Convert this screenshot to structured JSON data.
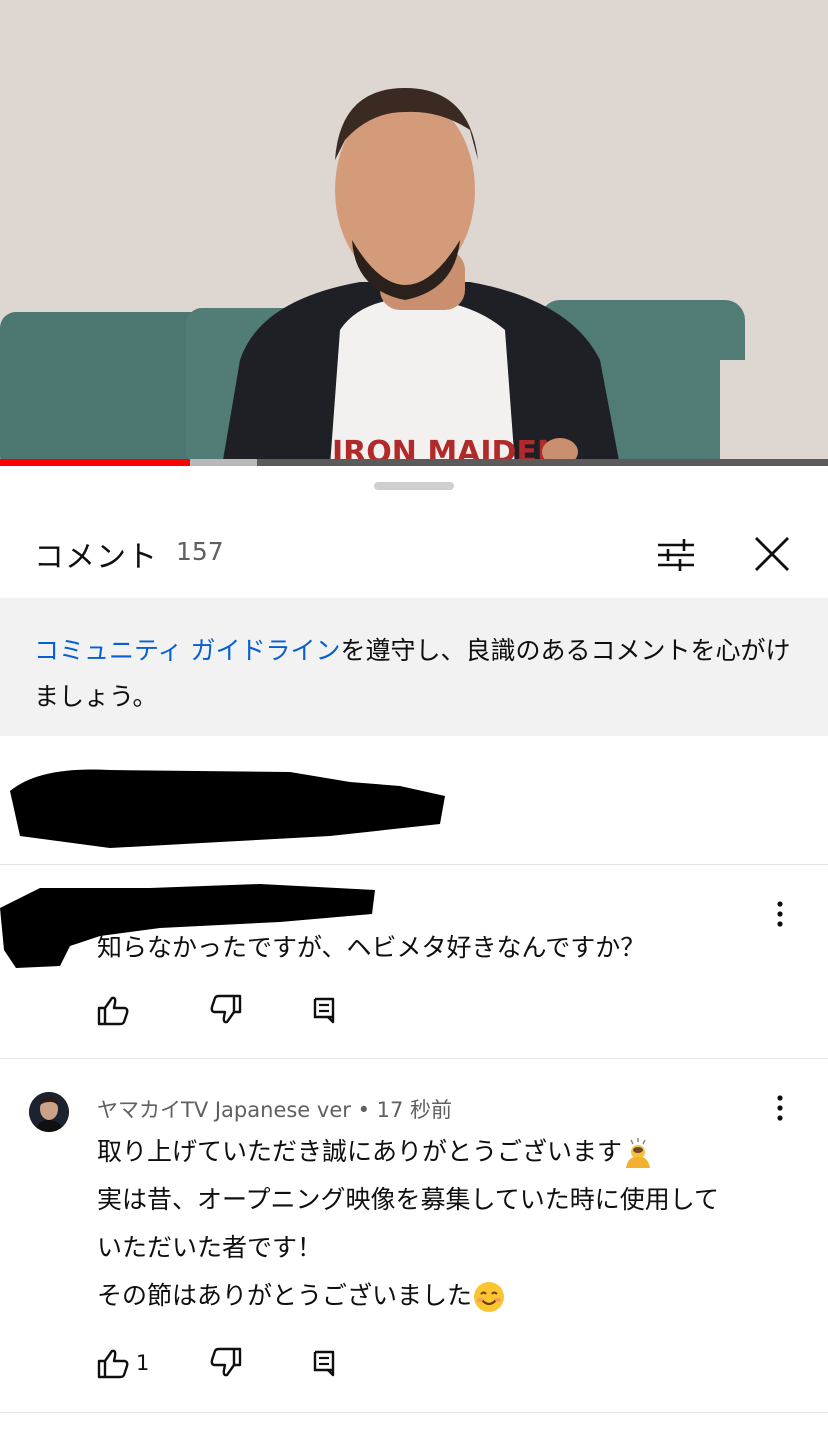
{
  "video": {
    "progress_played": 0.23,
    "progress_buffered": 0.31,
    "shirt_logo": "IRON MAIDEN"
  },
  "header": {
    "title": "コメント",
    "count": "157",
    "filter_icon": "tune-icon",
    "close_icon": "close-icon"
  },
  "notice": {
    "link_text": "コミュニティ ガイドライン",
    "text": "を遵守し、良識のあるコメントを心がけましょう。"
  },
  "comments": [
    {
      "redacted_author": true,
      "text": "知らなかったですが、ヘビメタ好きなんですか？",
      "like_count": ""
    },
    {
      "author": "ヤマカイTV Japanese ver",
      "separator": "•",
      "time": "17 秒前",
      "lines": [
        "取り上げていただき誠にありがとうございます",
        "実は昔、オープニング映像を募集していた時に使用して",
        "いただいた者です！",
        "その節はありがとうございました"
      ],
      "line1_emoji": "bowing-person-emoji",
      "line4_emoji": "smiling-face-emoji",
      "like_count": "1"
    }
  ],
  "colors": {
    "link": "#065fd4",
    "progress": "#ff0000",
    "notice_bg": "#f2f2f2"
  }
}
